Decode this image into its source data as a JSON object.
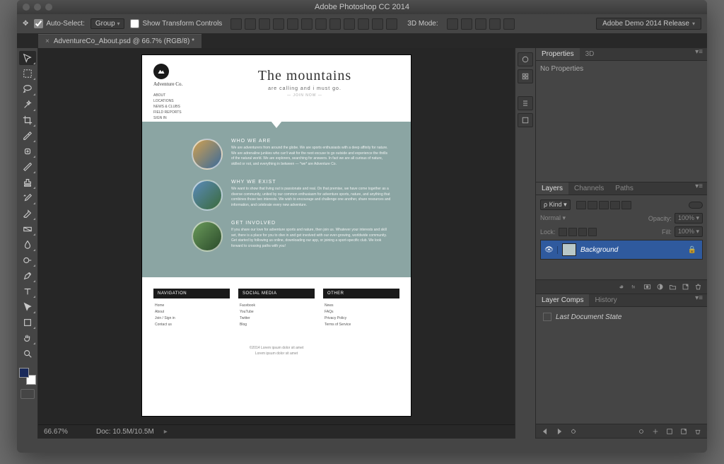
{
  "window": {
    "title": "Adobe Photoshop CC 2014"
  },
  "optionsBar": {
    "autoSelectLabel": "Auto-Select:",
    "autoSelectValue": "Group",
    "showTransformLabel": "Show Transform Controls",
    "modeLabel": "3D Mode:",
    "workspace": "Adobe Demo 2014 Release"
  },
  "document": {
    "tabLabel": "AdventureCo_About.psd @ 66.7% (RGB/8) *",
    "zoom": "66.67%",
    "docSize": "Doc: 10.5M/10.5M"
  },
  "artboard": {
    "company": "Adventure Co.",
    "nav": [
      "ABOUT",
      "LOCATIONS",
      "NEWS & CLUBS",
      "FIELD REPORTS",
      "SIGN IN"
    ],
    "heroTitle": "The mountains",
    "heroSubtitle": "are calling and I must go.",
    "joinNow": "— JOIN NOW —",
    "sections": [
      {
        "title": "WHO WE ARE",
        "body": "We are adventurers from around the globe. We are sports enthusiasts with a deep affinity for nature. We are adrenaline junkies who can't wait for the next excuse to go outside and experience the thrills of the natural world. We are explorers, searching for answers. In fact we are all curious of nature, skilled or not, and everything in between — *we* are Adventure Co."
      },
      {
        "title": "WHY WE EXIST",
        "body": "We want to show that living out is passionate and real. On that premise, we have come together as a diverse community, united by our common enthusiasm for adventure sports, nature, and anything that combines those two interests. We wish to encourage and challenge one another, share resources and information, and celebrate every new adventure."
      },
      {
        "title": "GET INVOLVED",
        "body": "If you share our love for adventure sports and nature, then join us. Whatever your interests and skill set, there is a place for you to dive in and get involved with our ever-growing, worldwide community. Get started by following us online, downloading our app, or joining a sport-specific club. We look forward to crossing paths with you!"
      }
    ],
    "footer": {
      "cols": [
        {
          "title": "NAVIGATION",
          "items": [
            "Home",
            "About",
            "Join / Sign in",
            "Contact us"
          ]
        },
        {
          "title": "SOCIAL MEDIA",
          "items": [
            "Facebook",
            "YouTube",
            "Twitter",
            "Blog"
          ]
        },
        {
          "title": "OTHER",
          "items": [
            "News",
            "FAQs",
            "Privacy Policy",
            "Terms of Service"
          ]
        }
      ],
      "copyright1": "©2014 Lorem ipsum dolor sit amet",
      "copyright2": "Lorem ipsum dolor sit amet"
    }
  },
  "panels": {
    "properties": {
      "tab1": "Properties",
      "tab2": "3D",
      "empty": "No Properties"
    },
    "layers": {
      "tab1": "Layers",
      "tab2": "Channels",
      "tab3": "Paths",
      "kindLabel": "Kind",
      "blendMode": "Normal",
      "opacityLabel": "Opacity:",
      "opacityValue": "100%",
      "lockLabel": "Lock:",
      "fillLabel": "Fill:",
      "fillValue": "100%",
      "layerName": "Background"
    },
    "layerComps": {
      "tab1": "Layer Comps",
      "tab2": "History",
      "lastState": "Last Document State"
    }
  }
}
